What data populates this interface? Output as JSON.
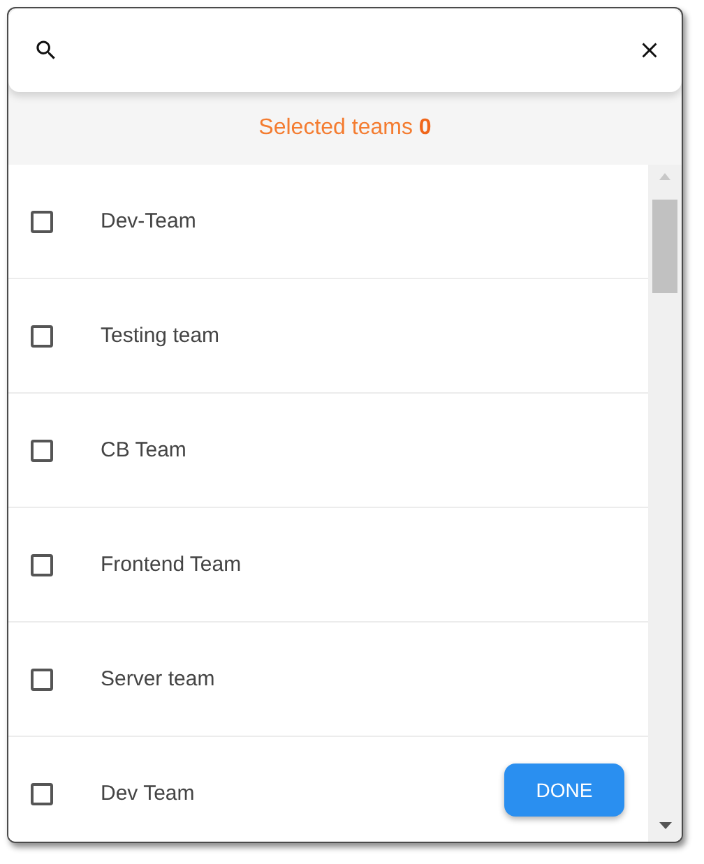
{
  "selected_summary": "Selected teams **0**",
  "teams": [
    {
      "name": "Dev-Team",
      "checked": false
    },
    {
      "name": "Testing team",
      "checked": false
    },
    {
      "name": "CB Team",
      "checked": false
    },
    {
      "name": "Frontend Team",
      "checked": false
    },
    {
      "name": "Server team",
      "checked": false
    },
    {
      "name": "Dev Team",
      "checked": false
    }
  ],
  "done_button": "DONE"
}
